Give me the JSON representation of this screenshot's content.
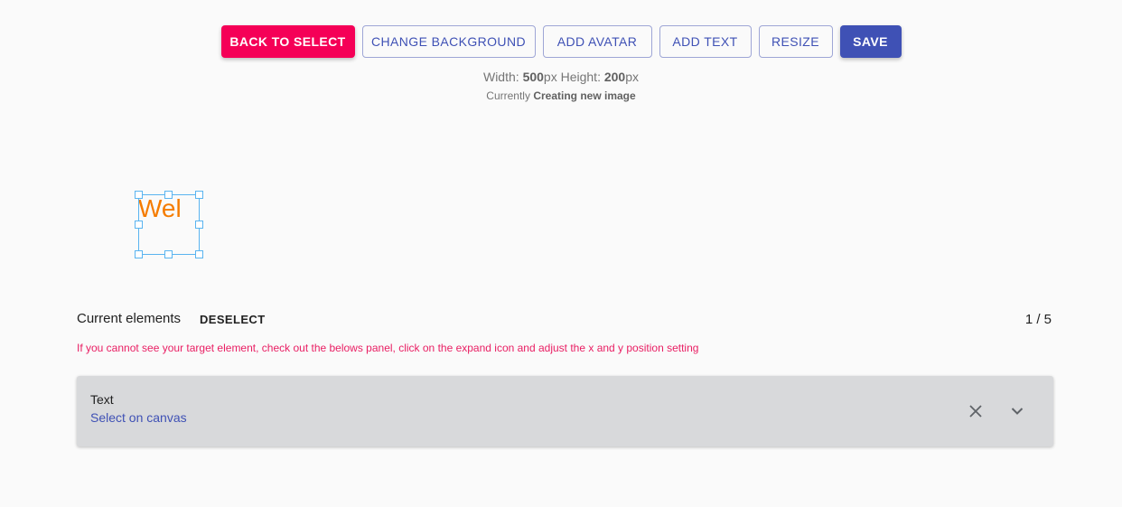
{
  "toolbar": {
    "back": "BACK TO SELECT",
    "change_background": "CHANGE BACKGROUND",
    "add_avatar": "ADD AVATAR",
    "add_text": "ADD TEXT",
    "resize": "RESIZE",
    "save": "SAVE"
  },
  "dimensions": {
    "width_label": "Width: ",
    "width_value": "500",
    "unit1": "px Height: ",
    "height_value": "200",
    "unit2": "px"
  },
  "status": {
    "prefix": "Currently ",
    "value": "Creating new image"
  },
  "canvas": {
    "text": "Wel",
    "text_color": "#f57c00",
    "selection_color": "#5ab4f0"
  },
  "elements": {
    "title": "Current elements",
    "deselect": "DESELECT",
    "pager": "1 / 5",
    "warning": "If you cannot see your target element, check out the belows panel, click on the expand icon and adjust the x and y position setting",
    "items": [
      {
        "type": "Text",
        "action": "Select on canvas",
        "icons": [
          "close-icon",
          "chevron-down-icon"
        ]
      }
    ]
  },
  "colors": {
    "primary": "#3f51b5",
    "secondary": "#f50057"
  }
}
